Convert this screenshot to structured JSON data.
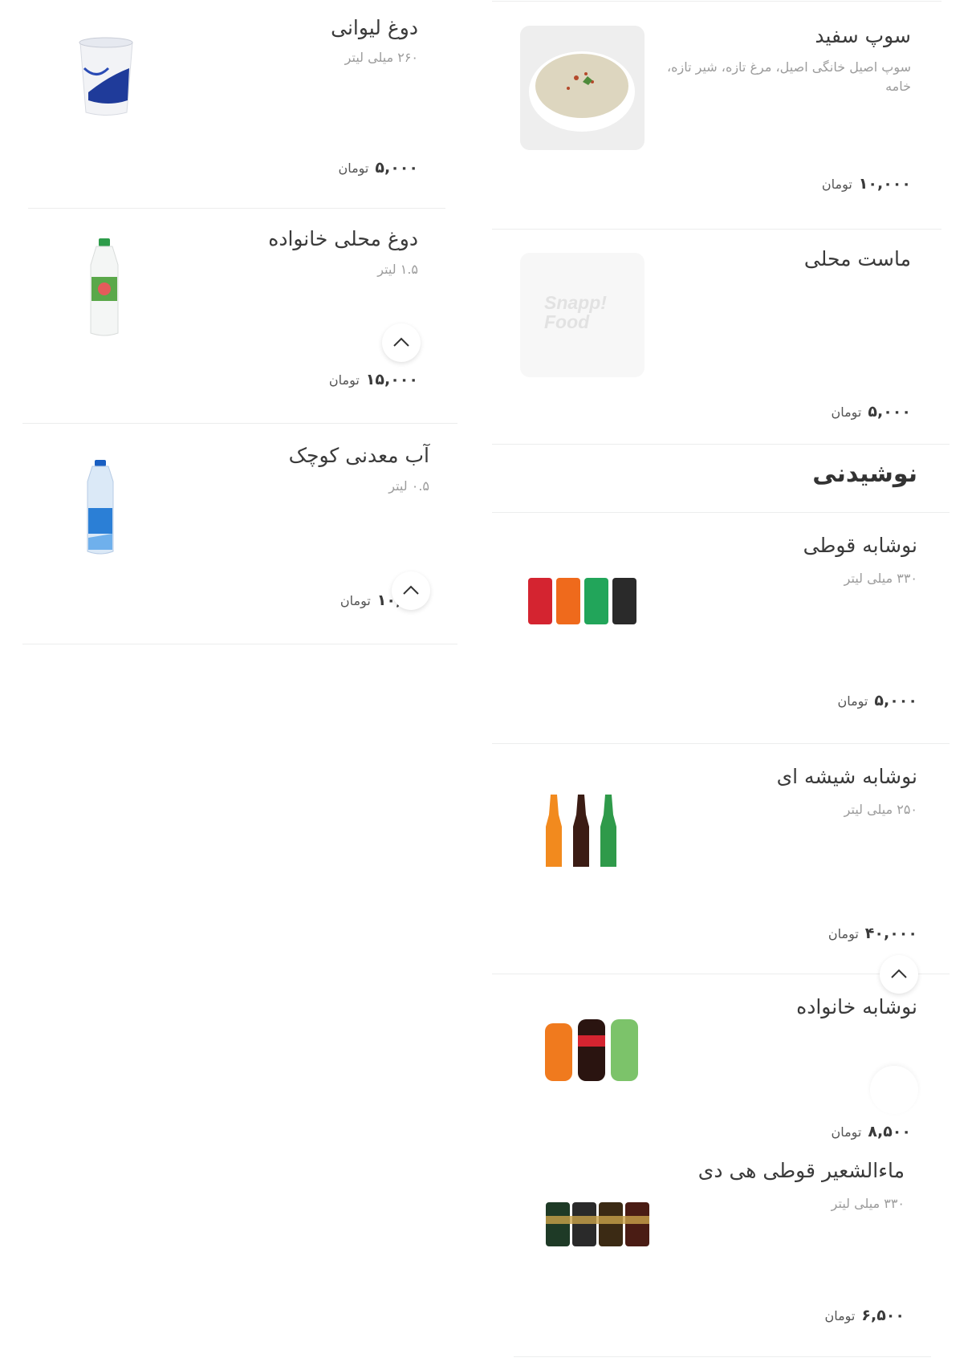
{
  "right_column": {
    "soup": {
      "title": "سوپ سفید",
      "desc": "سوپ اصیل خانگی اصیل، مرغ تازه، شیر تازه، خامه",
      "price": "۱۰,۰۰۰",
      "currency": "تومان"
    },
    "yogurt": {
      "title": "ماست محلی",
      "price": "۵,۰۰۰",
      "currency": "تومان",
      "placeholder_logo": "Snapp! Food"
    },
    "drinks_section_title": "نوشیدنی",
    "can_drink": {
      "title": "نوشابه قوطی",
      "desc": "۳۳۰ میلی لیتر",
      "price": "۵,۰۰۰",
      "currency": "تومان"
    },
    "glass_drink": {
      "title": "نوشابه شیشه ای",
      "desc": "۲۵۰ میلی لیتر",
      "price": "۴۰,۰۰۰",
      "currency": "تومان"
    },
    "family_drink": {
      "title": "نوشابه خانواده",
      "price": "۸,۵۰۰",
      "currency": "تومان"
    },
    "malt_can": {
      "title": "ماءالشعیر قوطی هی دی",
      "desc": "۳۳۰ میلی لیتر",
      "price": "۶,۵۰۰",
      "currency": "تومان"
    }
  },
  "left_column": {
    "doogh_cup": {
      "title": "دوغ لیوانی",
      "desc": "۲۶۰ میلی لیتر",
      "price": "۵,۰۰۰",
      "currency": "تومان"
    },
    "doogh_family": {
      "title": "دوغ محلی خانواده",
      "desc": "۱.۵ لیتر",
      "price": "۱۵,۰۰۰",
      "currency": "تومان"
    },
    "water_small": {
      "title": "آب معدنی کوچک",
      "desc": "۰.۵ لیتر",
      "price": "۱۰,۰۰۰",
      "currency": "تومان"
    }
  },
  "colors": {
    "divider": "#eceded",
    "text": "#3a3a3a",
    "muted": "#9c9c9c"
  }
}
